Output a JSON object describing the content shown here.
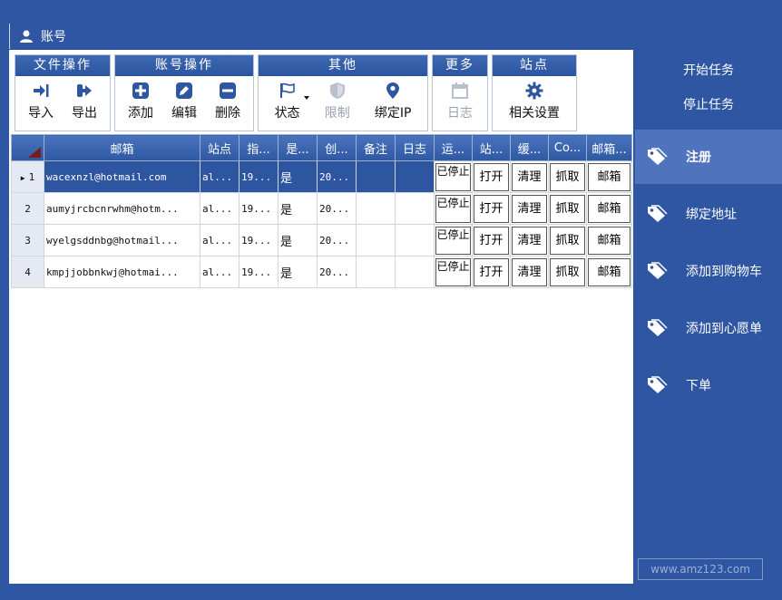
{
  "title": "账号",
  "ribbon": {
    "groups": [
      {
        "title": "文件操作",
        "buttons": [
          {
            "label": "导入",
            "icon": "import-icon"
          },
          {
            "label": "导出",
            "icon": "export-icon"
          }
        ]
      },
      {
        "title": "账号操作",
        "buttons": [
          {
            "label": "添加",
            "icon": "plus-icon"
          },
          {
            "label": "编辑",
            "icon": "edit-icon"
          },
          {
            "label": "删除",
            "icon": "minus-icon"
          }
        ]
      },
      {
        "title": "其他",
        "buttons": [
          {
            "label": "状态",
            "icon": "flag-icon"
          },
          {
            "label": "限制",
            "icon": "shield-icon"
          },
          {
            "label": "绑定IP",
            "icon": "location-pin-icon"
          }
        ]
      },
      {
        "title": "更多",
        "buttons": [
          {
            "label": "日志",
            "icon": "calendar-icon"
          }
        ]
      },
      {
        "title": "站点",
        "buttons": [
          {
            "label": "相关设置",
            "icon": "gear-icon"
          }
        ]
      }
    ]
  },
  "table": {
    "headers": [
      "邮箱",
      "站点",
      "指...",
      "是...",
      "创...",
      "备注",
      "日志",
      "运...",
      "站...",
      "缓...",
      "Co...",
      "邮箱..."
    ],
    "rows": [
      {
        "num": "1",
        "email": "wacexnzl@hotmail.com",
        "site": "al...",
        "ip": "19...",
        "flag": "是",
        "created": "20...",
        "note": "",
        "log": "",
        "status": "已停止",
        "open": "打开",
        "clear": "清理",
        "fetch": "抓取",
        "mail": "邮箱"
      },
      {
        "num": "2",
        "email": "aumyjrcbcnrwhm@hotm...",
        "site": "al...",
        "ip": "19...",
        "flag": "是",
        "created": "20...",
        "note": "",
        "log": "",
        "status": "已停止",
        "open": "打开",
        "clear": "清理",
        "fetch": "抓取",
        "mail": "邮箱"
      },
      {
        "num": "3",
        "email": "wyelgsddnbg@hotmail...",
        "site": "al...",
        "ip": "19...",
        "flag": "是",
        "created": "20...",
        "note": "",
        "log": "",
        "status": "已停止",
        "open": "打开",
        "clear": "清理",
        "fetch": "抓取",
        "mail": "邮箱"
      },
      {
        "num": "4",
        "email": "kmpjjobbnkwj@hotmai...",
        "site": "al...",
        "ip": "19...",
        "flag": "是",
        "created": "20...",
        "note": "",
        "log": "",
        "status": "已停止",
        "open": "打开",
        "clear": "清理",
        "fetch": "抓取",
        "mail": "邮箱"
      }
    ]
  },
  "tasks": {
    "start": "开始任务",
    "stop": "停止任务"
  },
  "nav": [
    {
      "label": "注册",
      "active": true
    },
    {
      "label": "绑定地址",
      "active": false
    },
    {
      "label": "添加到购物车",
      "active": false
    },
    {
      "label": "添加到心愿单",
      "active": false
    },
    {
      "label": "下单",
      "active": false
    }
  ],
  "watermark": "www.amz123.com"
}
